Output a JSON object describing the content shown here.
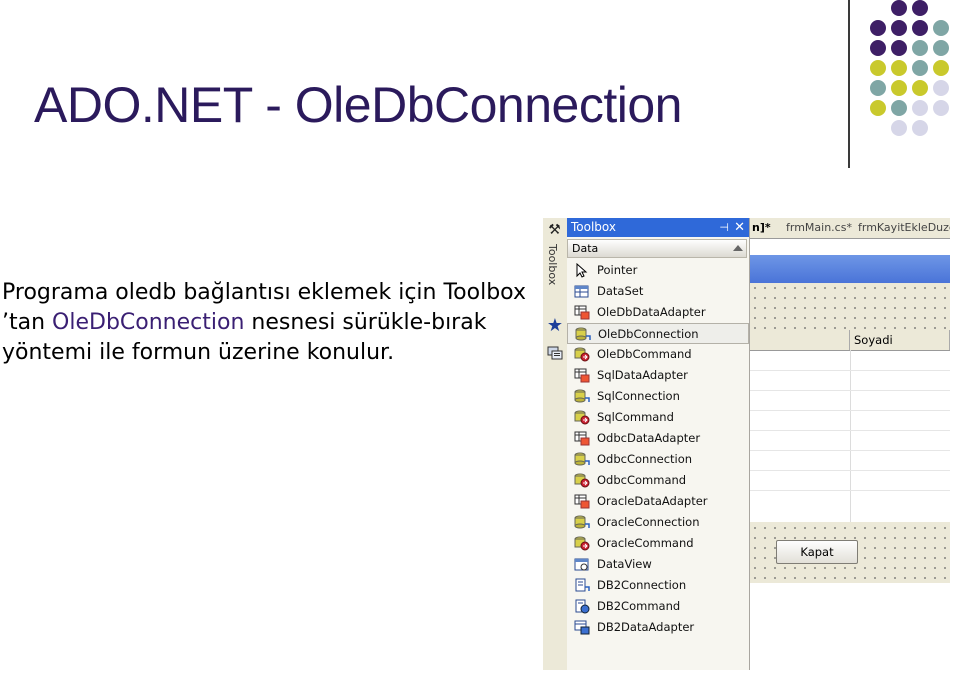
{
  "slide": {
    "title": "ADO.NET - OleDbConnection",
    "body_part1": "Programa oledb bağlantısı eklemek için Toolbox ’tan ",
    "body_highlight": "OleDbConnection",
    "body_part2": " nesnesi sürükle-bırak yöntemi ile formun üzerine konulur."
  },
  "colors": {
    "title": "#2b1a5c",
    "dot_purple": "#3e1f66",
    "dot_teal": "#7fa6a5",
    "dot_olive": "#c9c92c",
    "dot_lavender": "#d6d6e8",
    "toolbox_header": "#2f69d9"
  },
  "sidebar": {
    "tool_icon": "hammer-wrench-icon",
    "label": "Toolbox",
    "star_icon": "star-icon",
    "server_icon": "server-explorer-icon"
  },
  "toolbox": {
    "title": "Toolbox",
    "pin_glyph": "⊣",
    "close_glyph": "✕",
    "section": "Data",
    "items": [
      {
        "label": "Pointer",
        "icon": "pointer-icon"
      },
      {
        "label": "DataSet",
        "icon": "dataset-icon"
      },
      {
        "label": "OleDbDataAdapter",
        "icon": "data-adapter-icon"
      },
      {
        "label": "OleDbConnection",
        "icon": "connection-icon"
      },
      {
        "label": "OleDbCommand",
        "icon": "command-icon"
      },
      {
        "label": "SqlDataAdapter",
        "icon": "data-adapter-icon"
      },
      {
        "label": "SqlConnection",
        "icon": "connection-icon"
      },
      {
        "label": "SqlCommand",
        "icon": "command-icon"
      },
      {
        "label": "OdbcDataAdapter",
        "icon": "data-adapter-icon"
      },
      {
        "label": "OdbcConnection",
        "icon": "connection-icon"
      },
      {
        "label": "OdbcCommand",
        "icon": "command-icon"
      },
      {
        "label": "OracleDataAdapter",
        "icon": "data-adapter-icon"
      },
      {
        "label": "OracleConnection",
        "icon": "connection-icon"
      },
      {
        "label": "OracleCommand",
        "icon": "command-icon"
      },
      {
        "label": "DataView",
        "icon": "dataview-icon"
      },
      {
        "label": "DB2Connection",
        "icon": "db2-connection-icon"
      },
      {
        "label": "DB2Command",
        "icon": "db2-command-icon"
      },
      {
        "label": "DB2DataAdapter",
        "icon": "db2-adapter-icon"
      }
    ]
  },
  "designer": {
    "tabs": [
      "n]*",
      "frmMain.cs*",
      "frmKayitEkleDuzelt"
    ],
    "grid_column": "Soyadi",
    "button": "Kapat"
  }
}
